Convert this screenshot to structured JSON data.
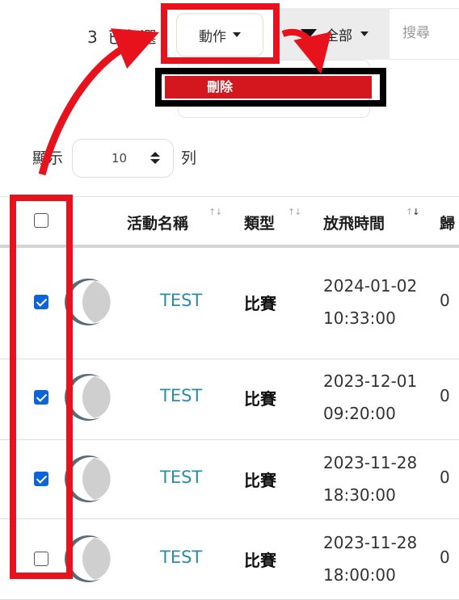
{
  "toolbar": {
    "selected_count": "3",
    "selected_label": "已勾選",
    "action_label": "動作",
    "filter_label": "全部",
    "search_placeholder": "搜尋"
  },
  "dropdown": {
    "delete_label": "刪除"
  },
  "pagination": {
    "show_label": "顯示",
    "page_size": "10",
    "rows_label": "列"
  },
  "table": {
    "headers": {
      "name": "活動名稱",
      "type": "類型",
      "time": "放飛時間",
      "extra": "歸"
    },
    "rows": [
      {
        "checked": true,
        "name": "TEST",
        "type": "比賽",
        "date": "2024-01-02",
        "time": "10:33:00",
        "extra": "0"
      },
      {
        "checked": true,
        "name": "TEST",
        "type": "比賽",
        "date": "2023-12-01",
        "time": "09:20:00",
        "extra": "0"
      },
      {
        "checked": true,
        "name": "TEST",
        "type": "比賽",
        "date": "2023-11-28",
        "time": "18:30:00",
        "extra": "0"
      },
      {
        "checked": false,
        "name": "TEST",
        "type": "比賽",
        "date": "2023-11-28",
        "time": "18:00:00",
        "extra": "0"
      }
    ]
  },
  "colors": {
    "annotation_red": "#e8121c",
    "link_blue": "#2a8ca7",
    "checkbox_blue": "#0b65d8",
    "delete_red": "#d4161e"
  }
}
